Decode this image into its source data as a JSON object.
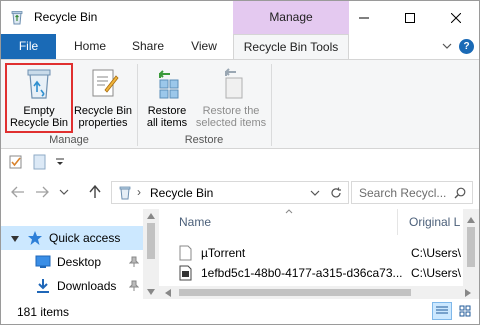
{
  "window": {
    "title": "Recycle Bin",
    "context_tab_header": "Manage"
  },
  "tabs": {
    "file": "File",
    "home": "Home",
    "share": "Share",
    "view": "View",
    "recycle_bin_tools": "Recycle Bin Tools",
    "help": "?"
  },
  "ribbon": {
    "empty_recycle_bin": "Empty Recycle Bin",
    "empty_line1": "Empty",
    "empty_line2": "Recycle Bin",
    "properties_line1": "Recycle Bin",
    "properties_line2": "properties",
    "restore_all_line1": "Restore",
    "restore_all_line2": "all items",
    "restore_selected_line1": "Restore the",
    "restore_selected_line2": "selected items",
    "group_manage": "Manage",
    "group_restore": "Restore"
  },
  "nav": {
    "address": "Recycle Bin",
    "search_placeholder": "Search Recycl..."
  },
  "navpane": {
    "items": [
      {
        "label": "Quick access"
      },
      {
        "label": "Desktop"
      },
      {
        "label": "Downloads"
      }
    ]
  },
  "content": {
    "columns": {
      "name": "Name",
      "original_location": "Original L"
    },
    "rows": [
      {
        "name": "µTorrent",
        "location": "C:\\Users\\"
      },
      {
        "name": "1efbd5c1-48b0-4177-a315-d36ca73...",
        "location": "C:\\Users\\"
      }
    ]
  },
  "status": {
    "item_count": "181 items"
  },
  "colors": {
    "file_tab": "#1a6ab6",
    "context_tab": "#e4c9f0",
    "selection": "#cce8ff",
    "highlight": "#e03030"
  },
  "icons": [
    "recycle-bin-icon",
    "properties-icon",
    "restore-all-icon",
    "restore-selected-icon",
    "pin-icon",
    "star-icon",
    "folder-icon",
    "download-icon",
    "search-icon"
  ]
}
